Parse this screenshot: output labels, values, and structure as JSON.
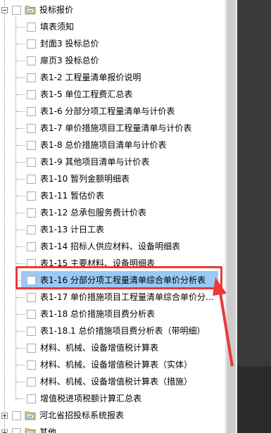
{
  "tree": {
    "root": {
      "label": "投标报价",
      "expanded": true,
      "icon": "folder-icon"
    },
    "items": [
      "填表须知",
      "封面3 投标总价",
      "扉页3 投标总价",
      "表1-2 工程量清单报价说明",
      "表1-5 单位工程费汇总表",
      "表1-6 分部分项工程量清单与计价表",
      "表1-7 单价措施项目工程量清单与计价表",
      "表1-8 总价措施项目清单与计价表",
      "表1-9 其他项目清单与计价表",
      "表1-10 暂列金额明细表",
      "表1-11 暂估价表",
      "表1-12 总承包服务费计价表",
      "表1-13 计日工表",
      "表1-14 招标人供应材料、设备明细表",
      "表1-15 主要材料、设备明细表",
      "表1-16 分部分项工程量清单综合单价分析表",
      "表1-17 单价措施项目工程量清单综合单价分…",
      "表1-18 总价措施项目费分析表",
      "表1-18.1 总价措施项目费分析表（带明细）",
      "材料、机械、设备增值税计算表",
      "材料、机械、设备增值税计算表（实体）",
      "材料、机械、设备增值税计算表（措施）",
      "增值税进项税额计算汇总表"
    ],
    "selected_item": "表1-16 分部分项工程量清单综合单价分析表",
    "folders": [
      {
        "label": "河北省招投标系统报表",
        "expanded": false,
        "icon": "folder-icon"
      },
      {
        "label": "其他",
        "expanded": false,
        "icon": "folder-icon"
      }
    ]
  },
  "colors": {
    "selection": "#99c9f5",
    "annotation": "#e83a3a"
  }
}
